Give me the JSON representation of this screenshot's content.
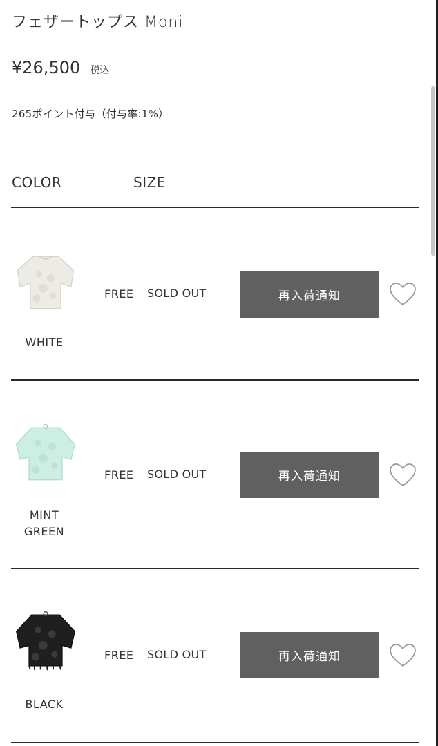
{
  "product": {
    "name": "フェザートップス Moni",
    "price": "¥26,500",
    "tax_label": "税込",
    "points_text": "265ポイント付与（付与率:1%）"
  },
  "table_header": {
    "color_label": "COLOR",
    "size_label": "SIZE"
  },
  "variants": [
    {
      "color_line1": "WHITE",
      "color_line2": "",
      "size": "FREE",
      "stock": "SOLD OUT",
      "notify_label": "再入荷通知",
      "thumb_color": "#ecebe6"
    },
    {
      "color_line1": "MINT",
      "color_line2": "GREEN",
      "size": "FREE",
      "stock": "SOLD OUT",
      "notify_label": "再入荷通知",
      "thumb_color": "#cdeee2"
    },
    {
      "color_line1": "BLACK",
      "color_line2": "",
      "size": "FREE",
      "stock": "SOLD OUT",
      "notify_label": "再入荷通知",
      "thumb_color": "#1f1f1f"
    }
  ],
  "colors": {
    "button_bg": "#606060",
    "text": "#333333",
    "divider": "#2a2a2a"
  },
  "icons": {
    "favorite": "heart-outline-icon"
  }
}
